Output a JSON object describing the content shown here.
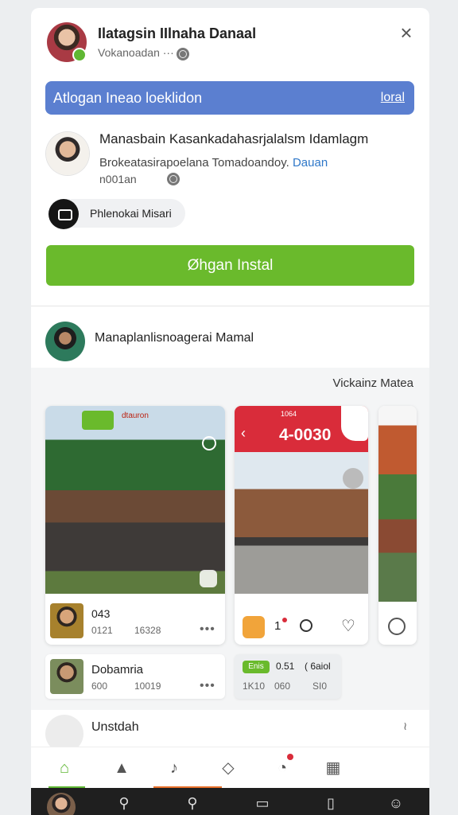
{
  "header": {
    "title": "Ilatagsin IIlnaha Danaal",
    "subtitle": "Vokanoadan ···",
    "close_icon": "close-icon",
    "globe_icon": "globe-icon"
  },
  "banner": {
    "text": "Atlogan Ineao loeklidon",
    "link": "loral",
    "color": "#5b7fd0"
  },
  "info": {
    "title": "Manasbain Kasankadahasrjalalsm Idamlagm",
    "description": "Brokeatasirapoelana Tomadoandoy.",
    "link": "Dauan",
    "code": "n001an"
  },
  "chip": {
    "label": "Phlenokai Misari"
  },
  "install_button": {
    "label": "Øhgan Instal",
    "color": "#6aba2c"
  },
  "section": {
    "title": "Manaplanlisnoagerai Mamal"
  },
  "gallery": {
    "label": "Vickainz Matea",
    "screens": [
      {
        "top_text": "dtauron",
        "caption": "043",
        "stat_a": "0121",
        "stat_b": "16328",
        "more": "•••"
      },
      {
        "status": "1064",
        "number": "4-0030",
        "bar_number": "1"
      }
    ]
  },
  "cards": [
    {
      "title": "Dobamria",
      "stat_a": "600",
      "stat_b": "10019",
      "more": "•••"
    },
    {
      "badge": "Enis",
      "num": "0.51",
      "paren": "( 6aiol",
      "stat_a": "1K10",
      "stat_b": "060",
      "stat_c": "SI0"
    }
  ],
  "next": {
    "title": "Unstdah",
    "mark": "≀"
  },
  "tabbar": {
    "tabs": [
      "home-icon",
      "thumbs-up-icon",
      "bell-icon",
      "bookmark-icon",
      "clock-icon",
      "calendar-icon"
    ]
  },
  "system_bar": {
    "icons": [
      "avatar",
      "search-icon",
      "search-icon",
      "chat-icon",
      "book-icon",
      "person-icon"
    ]
  }
}
